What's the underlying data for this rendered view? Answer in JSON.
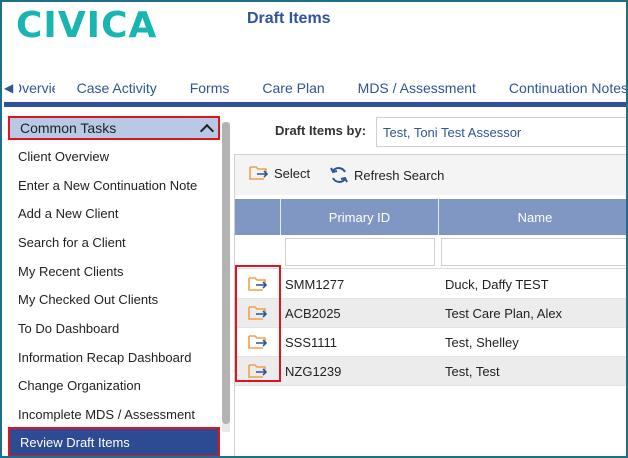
{
  "header": {
    "logo_text": "CIVICA",
    "page_title": "Draft Items"
  },
  "tabs": [
    {
      "label": "Overview"
    },
    {
      "label": "Case Activity"
    },
    {
      "label": "Forms"
    },
    {
      "label": "Care Plan"
    },
    {
      "label": "MDS / Assessment"
    },
    {
      "label": "Continuation Notes"
    }
  ],
  "sidebar": {
    "section_title": "Common Tasks",
    "items": [
      {
        "label": "Client Overview"
      },
      {
        "label": "Enter a New Continuation Note"
      },
      {
        "label": "Add a New Client"
      },
      {
        "label": "Search for a Client"
      },
      {
        "label": "My Recent Clients"
      },
      {
        "label": "My Checked Out Clients"
      },
      {
        "label": "To Do Dashboard"
      },
      {
        "label": "Information Recap Dashboard"
      },
      {
        "label": "Change Organization"
      },
      {
        "label": "Incomplete MDS / Assessment"
      }
    ],
    "selected_item": "Review Draft Items"
  },
  "main": {
    "filter_label": "Draft Items by:",
    "filter_value": "Test, Toni Test Assessor",
    "toolbar": {
      "select_label": "Select",
      "refresh_label": "Refresh Search"
    },
    "columns": [
      "",
      "Primary ID",
      "Name"
    ],
    "rows": [
      {
        "primary_id": "SMM1277",
        "name": "Duck, Daffy TEST"
      },
      {
        "primary_id": "ACB2025",
        "name": "Test Care Plan, Alex"
      },
      {
        "primary_id": "SSS1111",
        "name": "Test, Shelley"
      },
      {
        "primary_id": "NZG1239",
        "name": "Test, Test"
      }
    ]
  },
  "colors": {
    "brand": "#19b5b0",
    "title": "#2f5597",
    "nav_underline": "#2f4fa0",
    "highlight": "#e0141c",
    "selected_bg": "#2d4b93",
    "grid_header": "#7f97c2",
    "icon_orange": "#f0a04b"
  }
}
